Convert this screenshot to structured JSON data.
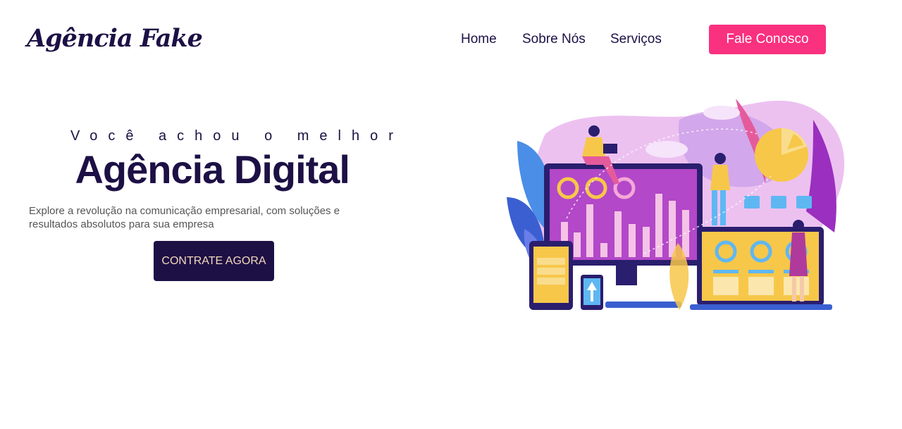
{
  "brand": {
    "logo_text": "Agência Fake"
  },
  "nav": {
    "items": [
      {
        "label": "Home"
      },
      {
        "label": "Sobre Nós"
      },
      {
        "label": "Serviços"
      }
    ],
    "cta_label": "Fale Conosco"
  },
  "hero": {
    "kicker": "Você achou o melhor",
    "headline": "Agência Digital",
    "description": "Explore a revolução na comunicação empresarial, com soluções e resultados absolutos para sua empresa",
    "button_label": "CONTRATE AGORA"
  },
  "colors": {
    "brand_dark": "#1d1045",
    "accent_pink": "#f9317f",
    "button_text": "#f6d8bd",
    "illustration_purple": "#a74fd1",
    "illustration_yellow": "#f7c74a"
  },
  "icons": {
    "illustration": "digital-marketing-illustration"
  }
}
